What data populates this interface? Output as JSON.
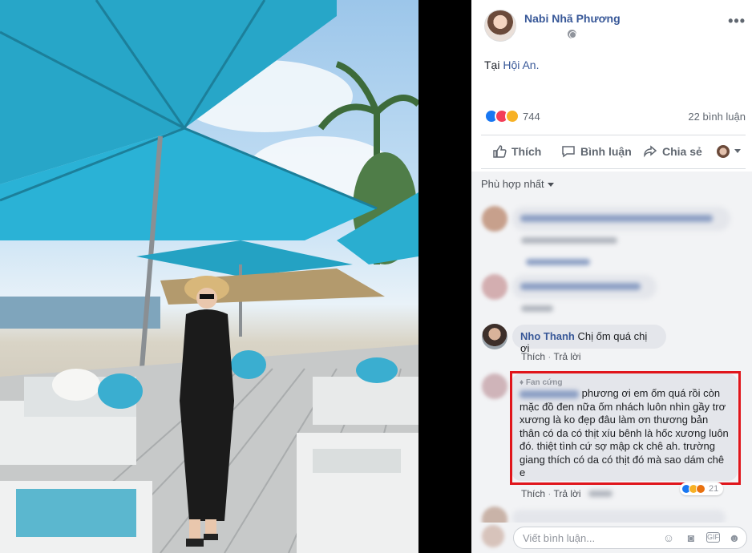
{
  "post": {
    "author": "Nabi Nhã Phương",
    "text_prefix": "Tại ",
    "location": "Hội An.",
    "reaction_count": "744",
    "comment_count": "22 bình luận"
  },
  "actions": {
    "like": "Thích",
    "comment": "Bình luận",
    "share": "Chia sẻ"
  },
  "sort": {
    "label": "Phù hợp nhất"
  },
  "comments": [
    {
      "name": "Nho Thanh",
      "text": "Chị ốm quá chị ơi",
      "like": "Thích",
      "reply": "Trả lời"
    },
    {
      "badge": "Fan cứng",
      "text": "phương ơi em ốm quá rồi còn mặc đồ đen nữa ốm nhách luôn nhìn gầy trơ xương là ko đẹp đâu làm ơn thương bản thân có da có thịt xíu bênh là hốc xương luôn đó. thiệt tình cứ sợ mập ck chê ah. trường giang thích có da có thịt đó mà sao dám chê e",
      "like": "Thích",
      "reply": "Trả lời",
      "reaction_count": "21"
    }
  ],
  "input": {
    "placeholder": "Viết bình luận..."
  },
  "colors": {
    "link": "#385898",
    "highlight": "#e0151b",
    "umbrella": "#27a6c8"
  }
}
